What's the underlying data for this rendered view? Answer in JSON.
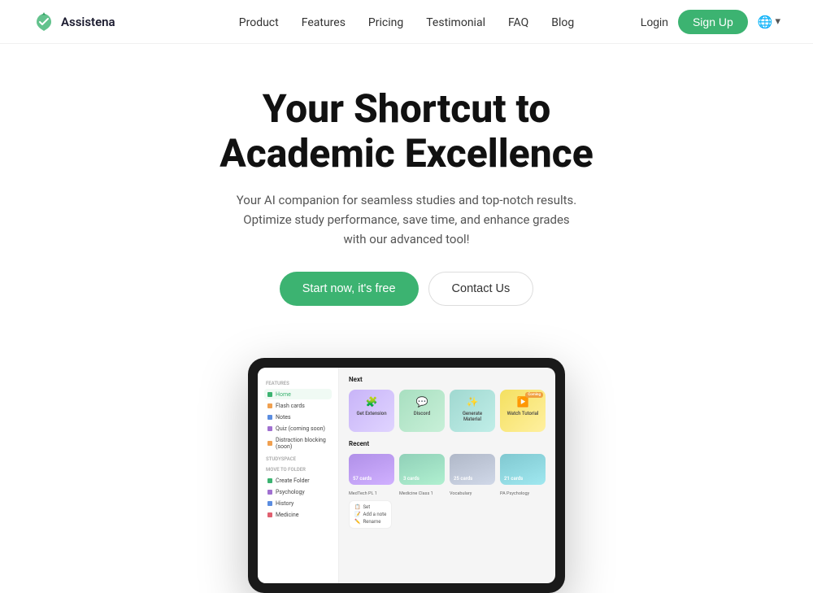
{
  "nav": {
    "logo_text": "Assistena",
    "links": [
      {
        "label": "Product",
        "id": "product"
      },
      {
        "label": "Features",
        "id": "features"
      },
      {
        "label": "Pricing",
        "id": "pricing"
      },
      {
        "label": "Testimonial",
        "id": "testimonial"
      },
      {
        "label": "FAQ",
        "id": "faq"
      },
      {
        "label": "Blog",
        "id": "blog"
      }
    ],
    "login_label": "Login",
    "signup_label": "Sign Up",
    "lang_symbol": "🌐",
    "lang_arrow": "▾"
  },
  "hero": {
    "heading_line1": "Your Shortcut to",
    "heading_line2": "Academic Excellence",
    "subtext": "Your AI companion for seamless studies and top-notch results. Optimize study performance, save time, and enhance grades with our advanced tool!",
    "cta_start": "Start now, it's free",
    "cta_contact": "Contact Us"
  },
  "app": {
    "sidebar": {
      "features_label": "Features",
      "items": [
        {
          "label": "Home",
          "color": "green",
          "active": true
        },
        {
          "label": "Flash cards",
          "color": "orange"
        },
        {
          "label": "Notes",
          "color": "blue"
        },
        {
          "label": "Quiz (coming soon)",
          "color": "purple"
        },
        {
          "label": "Distraction blocking (soon)",
          "color": "orange"
        }
      ],
      "studyspace_label": "Studyspace",
      "studyspace_items": [],
      "move_folder_label": "Move to folder",
      "folders": [
        {
          "label": "Create Folder"
        },
        {
          "label": "Psychology"
        },
        {
          "label": "History"
        },
        {
          "label": "Medicine"
        }
      ]
    },
    "main": {
      "next_label": "Next",
      "cards": [
        {
          "label": "Get Extension",
          "bg": "purple"
        },
        {
          "label": "Discord",
          "bg": "green"
        },
        {
          "label": "Generate Material",
          "bg": "teal"
        },
        {
          "label": "Watch Tutorial",
          "bg": "yellow",
          "coming": true
        }
      ],
      "recent_label": "Recent",
      "recent_cards": [
        {
          "count": "57 cards",
          "bg": "purple",
          "title": "MedTech PL 1"
        },
        {
          "count": "3 cards",
          "bg": "green",
          "title": "Medicine Class 1"
        },
        {
          "count": "25 cards",
          "bg": "gray",
          "title": "Vocabulary"
        },
        {
          "count": "21 cards",
          "bg": "teal",
          "title": "PA Psychology"
        }
      ],
      "mini_menu": [
        "Set",
        "Add a note",
        "Rename"
      ]
    }
  },
  "colors": {
    "brand_green": "#3cb371",
    "nav_border": "#f0f0f0"
  }
}
